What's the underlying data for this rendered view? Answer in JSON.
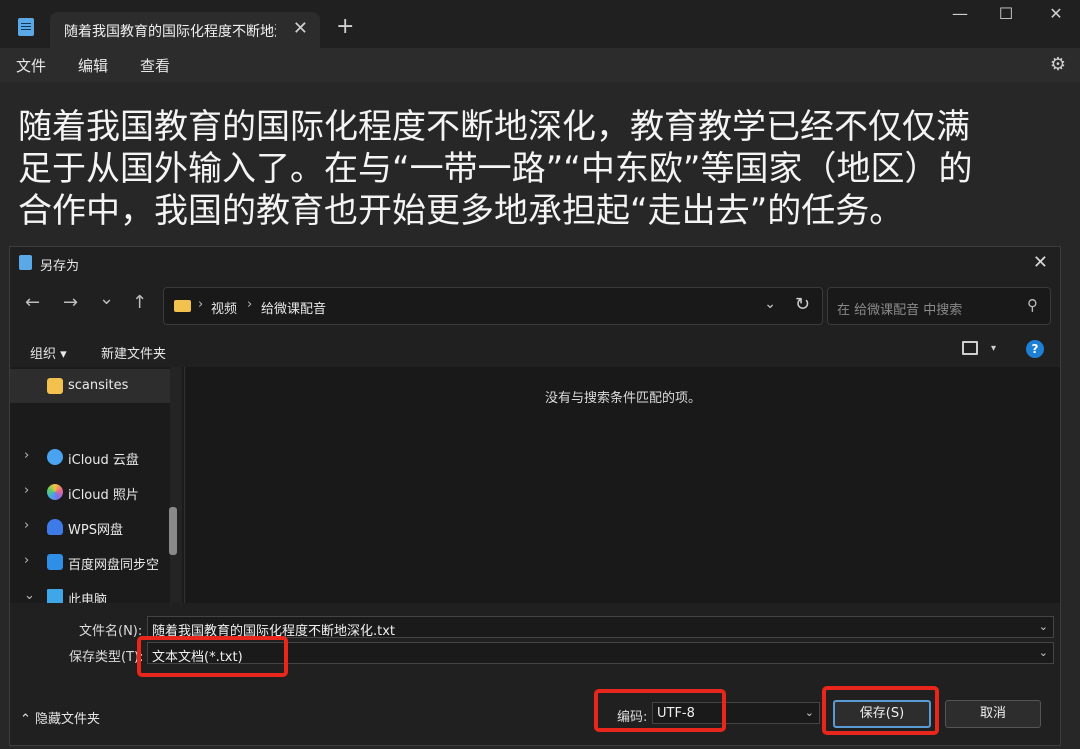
{
  "notepad": {
    "tab_title": "随着我国教育的国际化程度不断地深",
    "tab_close": "✕",
    "new_tab": "+",
    "window_controls": {
      "minimize": "—",
      "maximize": "☐",
      "close": "✕"
    },
    "menu": [
      "文件",
      "编辑",
      "查看"
    ],
    "settings_icon": "⚙",
    "text_lines": [
      "随着我国教育的国际化程度不断地深化，教育教学已经不仅仅满",
      "足于从国外输入了。在与“一带一路”“中东欧”等国家（地区）的",
      "合作中，我国的教育也开始更多地承担起“走出去”的任务。"
    ]
  },
  "dialog": {
    "title": "另存为",
    "close": "✕",
    "nav": {
      "back": "←",
      "forward": "→",
      "recent": "⌄",
      "up": "↑"
    },
    "breadcrumb": [
      "视频",
      "给微课配音"
    ],
    "breadcrumb_sep": "›",
    "address_dropdown": "⌄",
    "refresh": "↻",
    "search_placeholder": "在 给微课配音 中搜索",
    "search_icon": "⚲",
    "organize": "组织 ▾",
    "new_folder": "新建文件夹",
    "view_dropdown": "▾",
    "help": "?",
    "nav_items": [
      {
        "label": "scansites",
        "chevron": "",
        "color": "#f2c14e"
      },
      {
        "label": "iCloud 云盘",
        "chevron": "›",
        "color": "#4aa3f0"
      },
      {
        "label": "iCloud 照片",
        "chevron": "›",
        "color": "#e86a8a"
      },
      {
        "label": "WPS网盘",
        "chevron": "›",
        "color": "#3f7be8"
      },
      {
        "label": "百度网盘同步空",
        "chevron": "›",
        "color": "#2f8ee5"
      },
      {
        "label": "此电脑",
        "chevron": "⌄",
        "color": "#3fa7e8"
      }
    ],
    "empty_message": "没有与搜索条件匹配的项。",
    "filename_label": "文件名(N):",
    "filename_value": "随着我国教育的国际化程度不断地深化.txt",
    "filetype_label": "保存类型(T):",
    "filetype_value": "文本文档(*.txt)",
    "dropdown_glyph": "⌄",
    "hide_folders": "⌃ 隐藏文件夹",
    "encoding_label": "编码:",
    "encoding_value": "UTF-8",
    "save_button": "保存(S)",
    "cancel_button": "取消"
  },
  "colors": {
    "highlight": "#e8261c",
    "accent": "#5b9bd5",
    "help_blue": "#1e7fd6"
  }
}
